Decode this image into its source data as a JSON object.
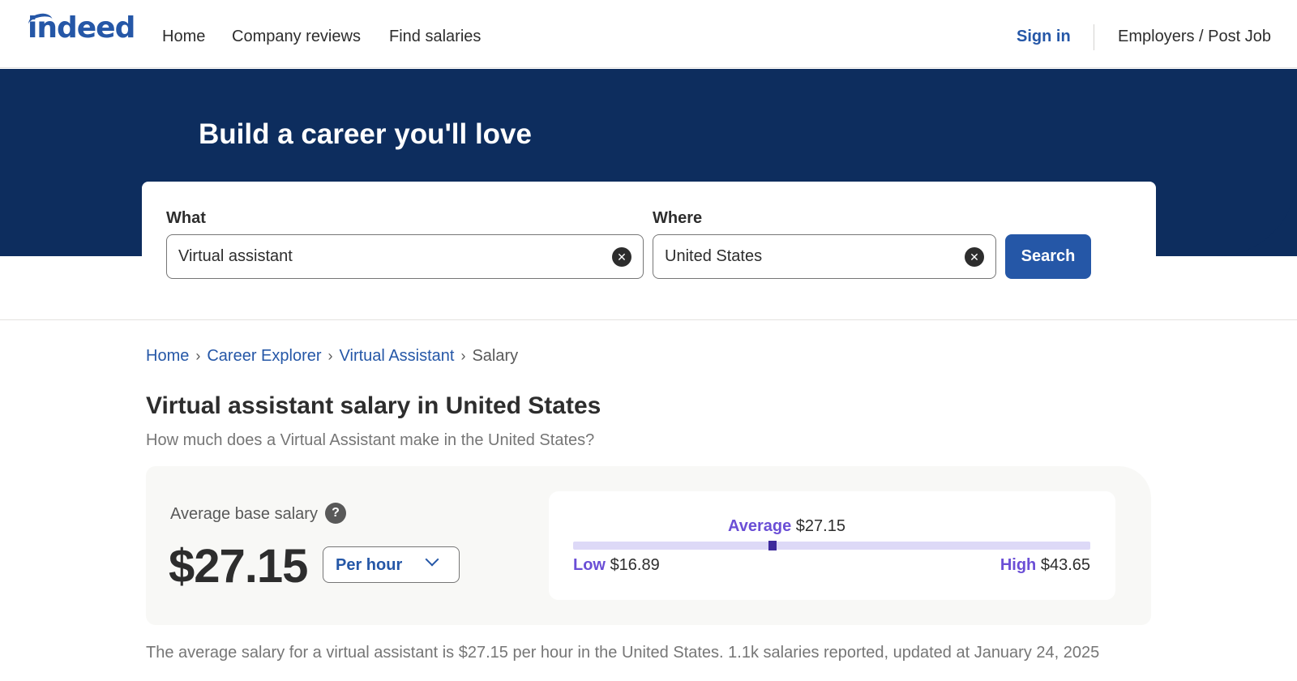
{
  "header": {
    "logo": "indeed",
    "nav": [
      "Home",
      "Company reviews",
      "Find salaries"
    ],
    "sign_in": "Sign in",
    "employers": "Employers / Post Job"
  },
  "hero": {
    "title": "Build a career you'll love"
  },
  "search": {
    "what_label": "What",
    "what_value": "Virtual assistant",
    "where_label": "Where",
    "where_value": "United States",
    "button": "Search"
  },
  "breadcrumb": {
    "items": [
      "Home",
      "Career Explorer",
      "Virtual Assistant"
    ],
    "current": "Salary"
  },
  "page": {
    "title": "Virtual assistant salary in United States",
    "subtitle": "How much does a Virtual Assistant make in the United States?"
  },
  "salary": {
    "avg_label": "Average base salary",
    "help_glyph": "?",
    "amount": "$27.15",
    "period": "Per hour",
    "average_label": "Average",
    "average_value": "$27.15",
    "low_label": "Low",
    "low_value": "$16.89",
    "high_label": "High",
    "high_value": "$43.65",
    "average_position_fraction": 0.385
  },
  "summary": "The average salary for a virtual assistant is $27.15 per hour in the United States.  1.1k salaries reported, updated at January 24, 2025",
  "colors": {
    "brand_blue": "#2557a7",
    "hero_navy": "#0d2d5e",
    "range_accent": "#6b4fd6",
    "range_bar": "#ddd9f7"
  }
}
